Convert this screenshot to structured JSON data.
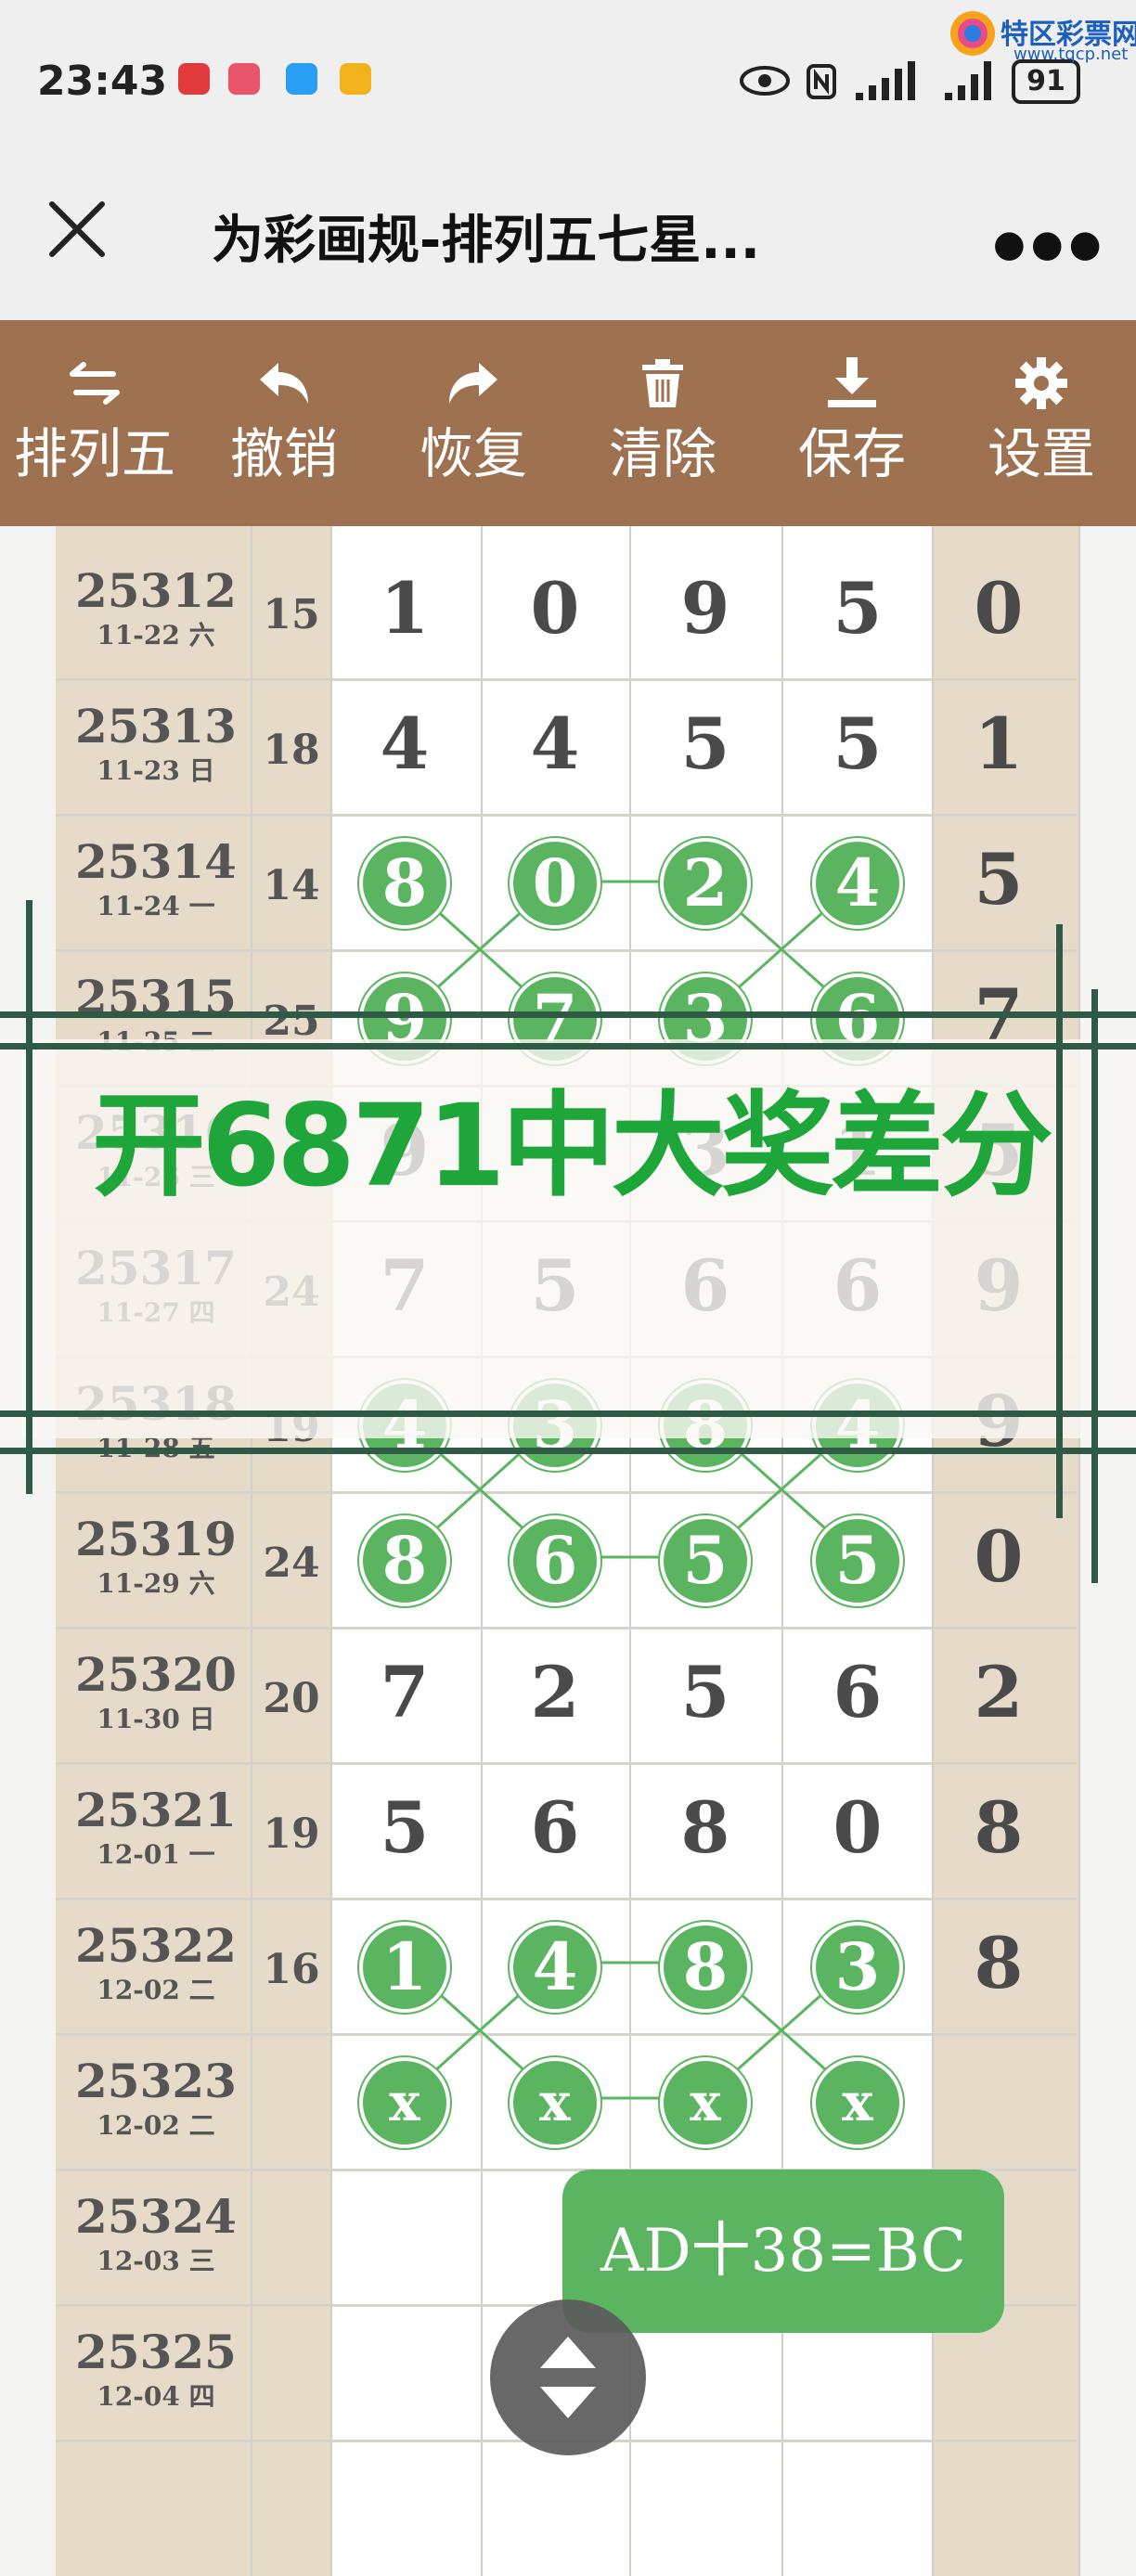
{
  "status_bar": {
    "time": "23:43",
    "battery": "91",
    "watermark_name": "特区彩票网",
    "watermark_url": "www.tqcp.net"
  },
  "titlebar": {
    "title": "为彩画规-排列五七星..."
  },
  "toolbar": {
    "items": [
      {
        "label": "排列五",
        "icon": "swap-icon"
      },
      {
        "label": "撤销",
        "icon": "undo-icon"
      },
      {
        "label": "恢复",
        "icon": "redo-icon"
      },
      {
        "label": "清除",
        "icon": "trash-icon"
      },
      {
        "label": "保存",
        "icon": "download-icon"
      },
      {
        "label": "设置",
        "icon": "gear-icon"
      }
    ]
  },
  "rows": [
    {
      "issue": "25312",
      "date": "11-22 六",
      "sum": "15",
      "digits": [
        "1",
        "0",
        "9",
        "5"
      ],
      "tail": "0",
      "circled": false
    },
    {
      "issue": "25313",
      "date": "11-23 日",
      "sum": "18",
      "digits": [
        "4",
        "4",
        "5",
        "5"
      ],
      "tail": "1",
      "circled": false
    },
    {
      "issue": "25314",
      "date": "11-24 一",
      "sum": "14",
      "digits": [
        "8",
        "0",
        "2",
        "4"
      ],
      "tail": "5",
      "circled": true
    },
    {
      "issue": "25315",
      "date": "11-25 二",
      "sum": "25",
      "digits": [
        "9",
        "7",
        "3",
        "6"
      ],
      "tail": "7",
      "circled": true
    },
    {
      "issue": "25316",
      "date": "11-26 三",
      "sum": "",
      "digits": [
        "9",
        "",
        "3",
        "1"
      ],
      "tail": "5",
      "circled": false
    },
    {
      "issue": "25317",
      "date": "11-27 四",
      "sum": "24",
      "digits": [
        "7",
        "5",
        "6",
        "6"
      ],
      "tail": "9",
      "circled": false
    },
    {
      "issue": "25318",
      "date": "11-28 五",
      "sum": "19",
      "digits": [
        "4",
        "3",
        "8",
        "4"
      ],
      "tail": "9",
      "circled": true
    },
    {
      "issue": "25319",
      "date": "11-29 六",
      "sum": "24",
      "digits": [
        "8",
        "6",
        "5",
        "5"
      ],
      "tail": "0",
      "circled": true
    },
    {
      "issue": "25320",
      "date": "11-30 日",
      "sum": "20",
      "digits": [
        "7",
        "2",
        "5",
        "6"
      ],
      "tail": "2",
      "circled": false
    },
    {
      "issue": "25321",
      "date": "12-01 一",
      "sum": "19",
      "digits": [
        "5",
        "6",
        "8",
        "0"
      ],
      "tail": "8",
      "circled": false
    },
    {
      "issue": "25322",
      "date": "12-02 二",
      "sum": "16",
      "digits": [
        "1",
        "4",
        "8",
        "3"
      ],
      "tail": "8",
      "circled": true
    },
    {
      "issue": "25323",
      "date": "12-02 二",
      "sum": "",
      "digits": [
        "x",
        "x",
        "x",
        "x"
      ],
      "tail": "",
      "circled": true
    },
    {
      "issue": "25324",
      "date": "12-03 三",
      "sum": "",
      "digits": [
        "",
        "",
        "",
        ""
      ],
      "tail": "",
      "circled": false
    },
    {
      "issue": "25325",
      "date": "12-04 四",
      "sum": "",
      "digits": [
        "",
        "",
        "",
        ""
      ],
      "tail": "",
      "circled": false
    }
  ],
  "overlay": {
    "text": "开6871中大奖差分"
  },
  "formula": "AD十38=BC",
  "colors": {
    "toolbar": "#9e7150",
    "circle_green": "#5bb560",
    "overlay_text": "#1fa63a",
    "overlay_lines": "#2f5a46",
    "side_column": "#e6dac8"
  }
}
